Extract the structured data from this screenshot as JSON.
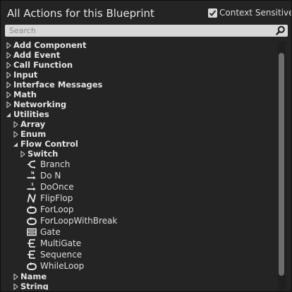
{
  "header": {
    "title": "All Actions for this Blueprint",
    "context_sensitive_label": "Context Sensitive",
    "context_sensitive_checked": true
  },
  "search": {
    "placeholder": "Search",
    "value": ""
  },
  "tree": {
    "add_component": "Add Component",
    "add_event": "Add Event",
    "call_function": "Call Function",
    "input": "Input",
    "interface_messages": "Interface Messages",
    "math": "Math",
    "networking": "Networking",
    "utilities": "Utilities",
    "array": "Array",
    "enum": "Enum",
    "flow_control": "Flow Control",
    "switch": "Switch",
    "branch": "Branch",
    "do_n": "Do N",
    "do_once": "DoOnce",
    "flip_flop": "FlipFlop",
    "for_loop": "ForLoop",
    "for_loop_with_break": "ForLoopWithBreak",
    "gate": "Gate",
    "multi_gate": "MultiGate",
    "sequence": "Sequence",
    "while_loop": "WhileLoop",
    "name": "Name",
    "string": "String"
  },
  "icons": {
    "branch": "branch-icon",
    "do_n": "do-n-icon",
    "do_once": "do-once-icon",
    "flip_flop": "flip-flop-icon",
    "loop": "loop-icon",
    "gate": "gate-icon",
    "multi": "multi-exec-icon",
    "search": "search-icon",
    "collapsed": "triangle-right-icon",
    "expanded": "triangle-down-icon"
  },
  "colors": {
    "panel": "#242424",
    "search_bg": "#d8d8d8",
    "scroll_thumb": "#6d6d6d",
    "text": "#e8e8e8"
  }
}
